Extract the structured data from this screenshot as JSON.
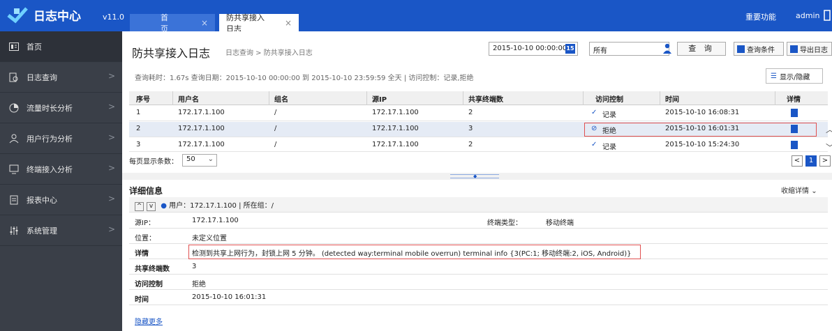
{
  "app": {
    "title": "日志中心",
    "version": "v11.0"
  },
  "tabs": [
    {
      "label": "首页",
      "close": "×"
    },
    {
      "label": "防共享接入日志",
      "close": "×"
    }
  ],
  "topbar": {
    "important": "重要功能",
    "user": "admin"
  },
  "sidebar": {
    "items": [
      {
        "label": "首页",
        "icon": "home-icon"
      },
      {
        "label": "日志查询",
        "icon": "log-search-icon",
        "chevron": ">"
      },
      {
        "label": "流量时长分析",
        "icon": "traffic-chart-icon",
        "chevron": ">"
      },
      {
        "label": "用户行为分析",
        "icon": "user-icon",
        "chevron": ">"
      },
      {
        "label": "终端接入分析",
        "icon": "monitor-icon",
        "chevron": ">"
      },
      {
        "label": "报表中心",
        "icon": "report-icon",
        "chevron": ">"
      },
      {
        "label": "系统管理",
        "icon": "settings-sliders-icon",
        "chevron": ">"
      }
    ]
  },
  "page": {
    "title": "防共享接入日志",
    "breadcrumb": "日志查询 > 防共享接入日志",
    "date_value": "2015-10-10 00:00:00",
    "calendar_label": "15",
    "select_value": "所有",
    "query_label": "查 询",
    "cond_label": "查询条件",
    "export_label": "导出日志",
    "stats": "查询耗时：1.67s   查询日期：2015-10-10 00:00:00 到 2015-10-10 23:59:59 全天  |  访问控制：记录,拒绝",
    "toggle_label": "显示/隐藏"
  },
  "table": {
    "headers": [
      "序号",
      "用户名",
      "组名",
      "源IP",
      "共享终端数",
      "访问控制",
      "时间",
      "详情"
    ],
    "rows": [
      {
        "no": "1",
        "user": "172.17.1.100",
        "group": "/",
        "ip": "172.17.1.100",
        "count": "2",
        "glyph": "✓",
        "access": "记录",
        "time": "2015-10-10 16:08:31"
      },
      {
        "no": "2",
        "user": "172.17.1.100",
        "group": "/",
        "ip": "172.17.1.100",
        "count": "3",
        "glyph": "⊘",
        "access": "拒绝",
        "time": "2015-10-10 16:01:31"
      },
      {
        "no": "3",
        "user": "172.17.1.100",
        "group": "/",
        "ip": "172.17.1.100",
        "count": "2",
        "glyph": "✓",
        "access": "记录",
        "time": "2015-10-10 15:24:30"
      }
    ]
  },
  "pager": {
    "label": "每页显示条数：",
    "page_size": "50",
    "page": "1",
    "prev": "<",
    "next": ">",
    "caret": "⌄"
  },
  "detail": {
    "title": "详细信息",
    "collapse_label": "收缩详情",
    "collapse_glyph": "⌄",
    "up": "^",
    "down": "v",
    "user_line": "用户：172.17.1.100 | 所在组：/",
    "source_ip_label": "源IP：",
    "source_ip": "172.17.1.100",
    "terminal_type_label": "终端类型：",
    "terminal_type": "移动终端",
    "location_label": "位置：",
    "location": "未定义位置",
    "detail_label": "详情",
    "detail_value": "检测到共享上网行为，封锁上网 5 分钟。 (detected way:terminal mobile overrun) terminal info {3(PC:1; 移动终端:2, iOS, Android)}",
    "share_count_label": "共享终端数",
    "share_count": "3",
    "access_label": "访问控制",
    "access": "拒绝",
    "time_label": "时间",
    "time": "2015-10-10 16:01:31",
    "hide_more": "隐藏更多"
  },
  "colors": {
    "topbar": "#1a56c6",
    "sidebar": "#3a3f48",
    "accent": "#1a56c6",
    "highlight_border": "#e05050"
  }
}
